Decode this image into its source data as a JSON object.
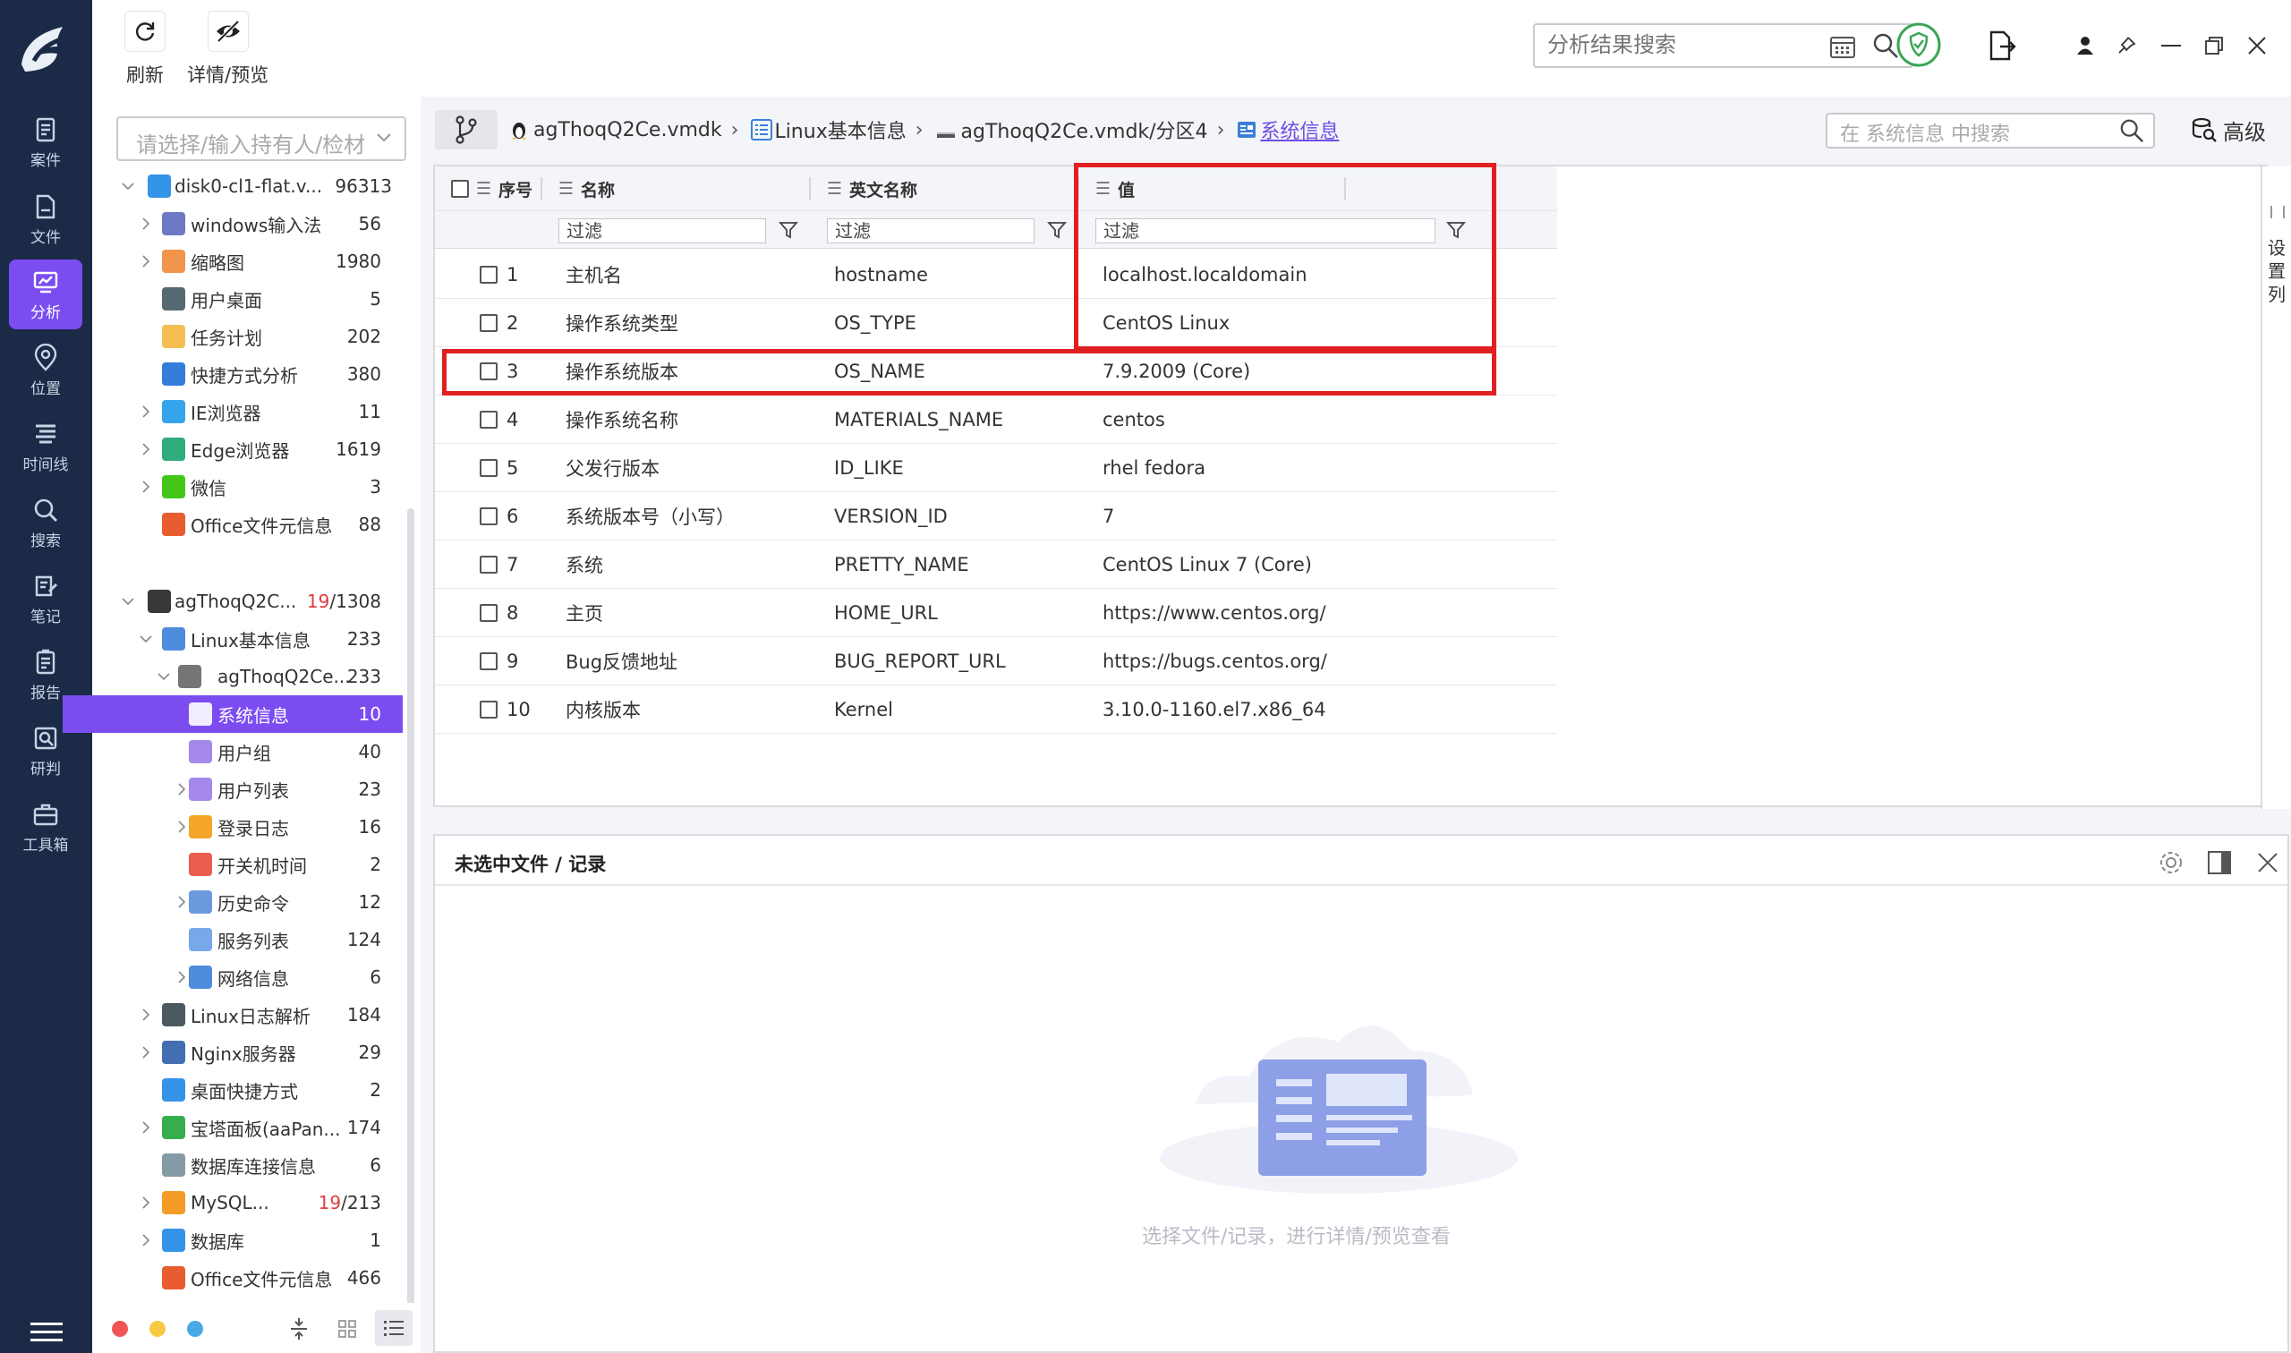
{
  "toolbar": {
    "refresh_label": "刷新",
    "detail_label": "详情/预览",
    "search_placeholder": "分析结果搜索"
  },
  "rail": {
    "items": [
      {
        "label": "案件",
        "icon": "case-icon"
      },
      {
        "label": "文件",
        "icon": "file-icon"
      },
      {
        "label": "分析",
        "icon": "analysis-icon",
        "active": true
      },
      {
        "label": "位置",
        "icon": "location-icon"
      },
      {
        "label": "时间线",
        "icon": "timeline-icon"
      },
      {
        "label": "搜索",
        "icon": "search-icon"
      },
      {
        "label": "笔记",
        "icon": "note-icon"
      },
      {
        "label": "报告",
        "icon": "report-icon"
      },
      {
        "label": "研判",
        "icon": "judge-icon"
      },
      {
        "label": "工具箱",
        "icon": "toolbox-icon"
      }
    ]
  },
  "tree": {
    "holder_placeholder": "请选择/输入持有人/检材",
    "rows": [
      {
        "label": "disk0-cl1-flat.v...",
        "count": "96313",
        "icon": "windows-icon"
      },
      {
        "label": "windows输入法",
        "count": "56",
        "icon": "keyboard-icon"
      },
      {
        "label": "缩略图",
        "count": "1980",
        "icon": "thumbnail-icon"
      },
      {
        "label": "用户桌面",
        "count": "5",
        "icon": "desktop-icon"
      },
      {
        "label": "任务计划",
        "count": "202",
        "icon": "task-icon"
      },
      {
        "label": "快捷方式分析",
        "count": "380",
        "icon": "shortcut-icon"
      },
      {
        "label": "IE浏览器",
        "count": "11",
        "icon": "ie-icon"
      },
      {
        "label": "Edge浏览器",
        "count": "1619",
        "icon": "edge-icon"
      },
      {
        "label": "微信",
        "count": "3",
        "icon": "wechat-icon"
      },
      {
        "label": "Office文件元信息",
        "count": "88",
        "icon": "office-icon"
      },
      {
        "label": "agThoqQ2C...",
        "count_red": "19",
        "count": "/1308",
        "icon": "linux-icon"
      },
      {
        "label": "Linux基本信息",
        "count": "233",
        "icon": "list-icon"
      },
      {
        "label": "agThoqQ2Ce...",
        "count": "233",
        "icon": "partition-icon"
      },
      {
        "label": "系统信息",
        "count": "10",
        "icon": "sysinfo-icon"
      },
      {
        "label": "用户组",
        "count": "40",
        "icon": "usergroup-icon"
      },
      {
        "label": "用户列表",
        "count": "23",
        "icon": "userlist-icon"
      },
      {
        "label": "登录日志",
        "count": "16",
        "icon": "login-log-icon"
      },
      {
        "label": "开关机时间",
        "count": "2",
        "icon": "power-icon"
      },
      {
        "label": "历史命令",
        "count": "12",
        "icon": "terminal-icon"
      },
      {
        "label": "服务列表",
        "count": "124",
        "icon": "service-icon"
      },
      {
        "label": "网络信息",
        "count": "6",
        "icon": "network-icon"
      },
      {
        "label": "Linux日志解析",
        "count": "184",
        "icon": "log-icon"
      },
      {
        "label": "Nginx服务器",
        "count": "29",
        "icon": "server-icon"
      },
      {
        "label": "桌面快捷方式",
        "count": "2",
        "icon": "desktop-shortcut-icon"
      },
      {
        "label": "宝塔面板(aaPan...",
        "count": "174",
        "icon": "bt-panel-icon"
      },
      {
        "label": "数据库连接信息",
        "count": "6",
        "icon": "db-conn-icon"
      },
      {
        "label": "MySQL...",
        "count_red": "19",
        "count": "/213",
        "icon": "mysql-icon"
      },
      {
        "label": "数据库",
        "count": "1",
        "icon": "database-icon"
      },
      {
        "label": "Office文件元信息",
        "count": "466",
        "icon": "office-icon"
      }
    ]
  },
  "breadcrumb": {
    "items": [
      "agThoqQ2Ce.vmdk",
      "Linux基本信息",
      "agThoqQ2Ce.vmdk/分区4",
      "系统信息"
    ],
    "search_placeholder": "在 系统信息 中搜索",
    "advanced_label": "高级"
  },
  "grid": {
    "headers": {
      "seq": "序号",
      "name": "名称",
      "en": "英文名称",
      "value": "值"
    },
    "filter_text": "过滤",
    "side_label": "设置列",
    "rows": [
      {
        "seq": "1",
        "name": "主机名",
        "en": "hostname",
        "value": "localhost.localdomain"
      },
      {
        "seq": "2",
        "name": "操作系统类型",
        "en": "OS_TYPE",
        "value": "CentOS Linux"
      },
      {
        "seq": "3",
        "name": "操作系统版本",
        "en": "OS_NAME",
        "value": "7.9.2009 (Core)"
      },
      {
        "seq": "4",
        "name": "操作系统名称",
        "en": "MATERIALS_NAME",
        "value": "centos"
      },
      {
        "seq": "5",
        "name": "父发行版本",
        "en": "ID_LIKE",
        "value": "rhel fedora"
      },
      {
        "seq": "6",
        "name": "系统版本号（小写）",
        "en": "VERSION_ID",
        "value": "7"
      },
      {
        "seq": "7",
        "name": "系统",
        "en": "PRETTY_NAME",
        "value": "CentOS Linux 7 (Core)"
      },
      {
        "seq": "8",
        "name": "主页",
        "en": "HOME_URL",
        "value": "https://www.centos.org/"
      },
      {
        "seq": "9",
        "name": "Bug反馈地址",
        "en": "BUG_REPORT_URL",
        "value": "https://bugs.centos.org/"
      },
      {
        "seq": "10",
        "name": "内核版本",
        "en": "Kernel",
        "value": "3.10.0-1160.el7.x86_64"
      }
    ]
  },
  "detail": {
    "title": "未选中文件 / 记录",
    "empty_text": "选择文件/记录，进行详情/预览查看"
  },
  "colors": {
    "rail_bg": "#1b2a47",
    "accent": "#7b4df1",
    "highlight_box": "#e02020",
    "link": "#6e4ce5"
  }
}
